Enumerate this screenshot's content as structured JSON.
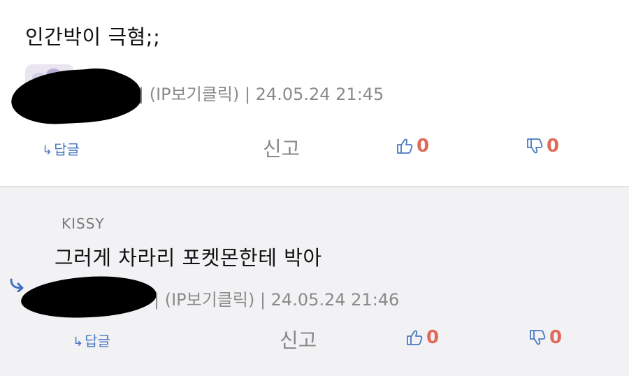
{
  "comments": [
    {
      "content": "인간박이 극혐;;",
      "meta": "| (IP보기클릭) | 24.05.24 21:45",
      "reply_label": "답글",
      "report_label": "신고",
      "likes": "0",
      "dislikes": "0"
    },
    {
      "author": "KISSY",
      "content": "그러게 차라리 포켓몬한테 박아",
      "meta": "| (IP보기클릭) | 24.05.24 21:46",
      "reply_label": "답글",
      "report_label": "신고",
      "likes": "0",
      "dislikes": "0"
    }
  ],
  "colors": {
    "accent_blue": "#4a78c2",
    "vote_red": "#e06a5a",
    "meta_gray": "#8a8a8a",
    "reply_bg": "#f2f2f4"
  },
  "icons": {
    "reply": "reply-arrow-icon",
    "like": "thumbs-up-icon",
    "dislike": "thumbs-down-icon"
  }
}
